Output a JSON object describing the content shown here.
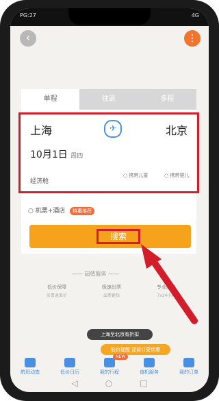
{
  "status": {
    "time": "PG:27",
    "right": "4G"
  },
  "header": {
    "back_symbol": "‹",
    "menu_symbol": "⋮"
  },
  "tabs": [
    {
      "label": "单程",
      "active": true
    },
    {
      "label": "往返",
      "active": false
    },
    {
      "label": "多程",
      "active": false
    }
  ],
  "flight": {
    "from": "上海",
    "to": "北京",
    "date_main": "10月1日",
    "date_sub": "周四",
    "cabin": "经济舱",
    "child_option": "携带儿童",
    "infant_option": "携带婴儿"
  },
  "check_row": {
    "label": "机票+酒店",
    "tag": "特惠推荐"
  },
  "search_button": {
    "label": "搜索"
  },
  "section_title": "—— 超值服务 ——",
  "features": [
    {
      "label": "低价保障",
      "sub": "买贵退差价"
    },
    {
      "label": "极速出票",
      "sub": "出票更快"
    },
    {
      "label": "专业服务",
      "sub": "7x24小时"
    }
  ],
  "toasts": {
    "dark": "上海至北京有折扣",
    "orange": "低价提醒 提前订更优惠"
  },
  "bottom_nav": [
    {
      "label": "航班动态"
    },
    {
      "label": "低价日历"
    },
    {
      "label": "我的行程",
      "badge": "NEW"
    },
    {
      "label": "值机服务"
    },
    {
      "label": "我的订单"
    }
  ],
  "system_nav": [
    "◁",
    "○",
    "□"
  ]
}
